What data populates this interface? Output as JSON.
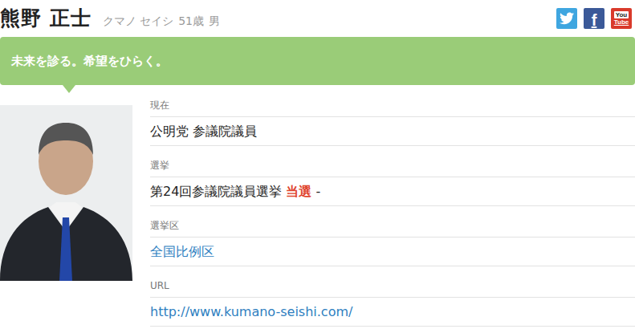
{
  "person": {
    "name": "熊野 正士",
    "kana": "クマノ セイシ",
    "age": "51歳",
    "gender": "男"
  },
  "social": {
    "facebook": "f",
    "youtube_top": "You",
    "youtube_bottom": "Tube"
  },
  "slogan": "未来を診る。希望をひらく。",
  "fields": [
    {
      "label": "現在",
      "parts": [
        {
          "text": "公明党 参議院議員",
          "kind": "plain"
        }
      ]
    },
    {
      "label": "選挙",
      "parts": [
        {
          "text": "第24回参議院議員選挙 ",
          "kind": "plain"
        },
        {
          "text": "当選",
          "kind": "result"
        },
        {
          "text": " -",
          "kind": "plain"
        }
      ]
    },
    {
      "label": "選挙区",
      "parts": [
        {
          "text": "全国比例区",
          "kind": "link"
        }
      ]
    },
    {
      "label": "URL",
      "parts": [
        {
          "text": "http://www.kumano-seishi.com/",
          "kind": "link"
        }
      ]
    }
  ]
}
